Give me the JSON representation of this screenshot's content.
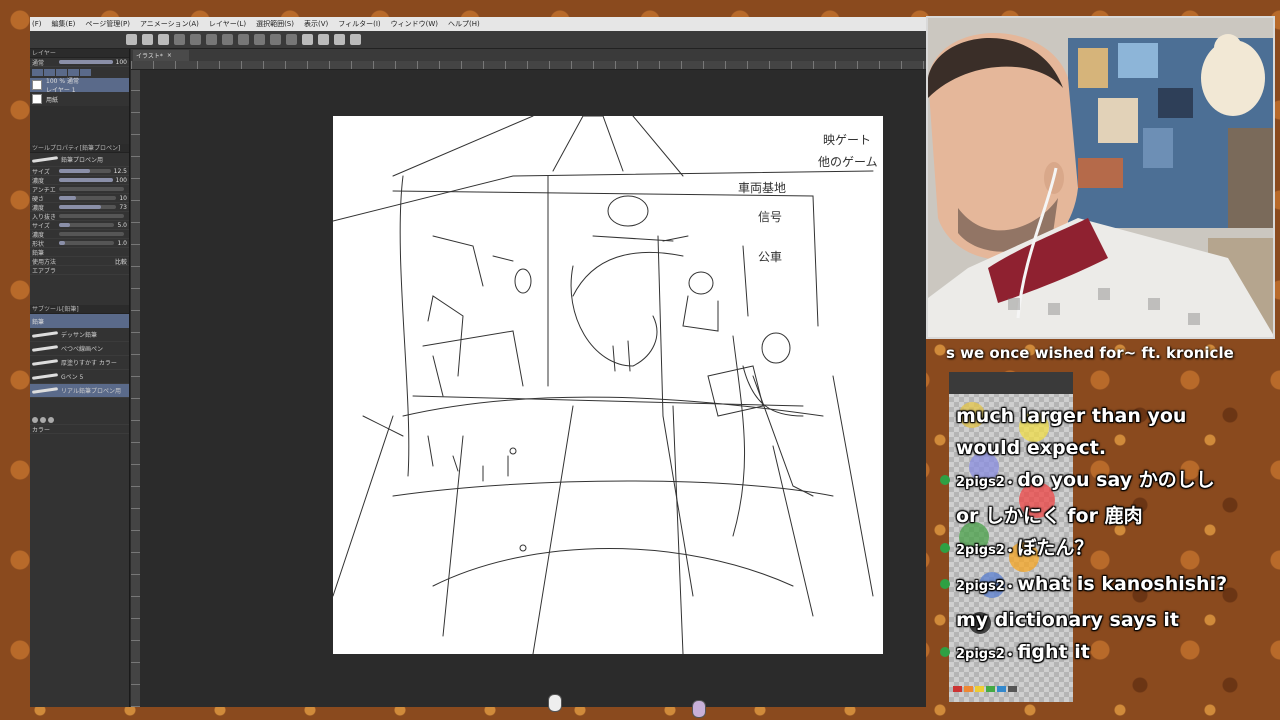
{
  "menu": [
    "(F)",
    "編集(E)",
    "ページ管理(P)",
    "アニメーション(A)",
    "レイヤー(L)",
    "選択範囲(S)",
    "表示(V)",
    "フィルター(I)",
    "ウィンドウ(W)",
    "ヘルプ(H)"
  ],
  "document_tab": "イラスト*",
  "left_panel": {
    "layer_header": "レイヤー",
    "blend_mode": "通常",
    "opacity": "100",
    "layers": [
      {
        "name": "100 % 通常",
        "sub": "レイヤー 1"
      },
      {
        "name": "用紙"
      }
    ],
    "tool_property_title": "ツールプロパティ[鉛筆プロペン]",
    "tool_name": "鉛筆プロペン用",
    "props": [
      {
        "label": "サイズ",
        "value": "12.5",
        "level": 0.6
      },
      {
        "label": "濃度",
        "value": "100",
        "level": 1.0
      },
      {
        "label": "アンチエイリアス",
        "value": "",
        "level": 0
      },
      {
        "label": "硬さ",
        "value": "10",
        "level": 0.3
      },
      {
        "label": "濃度",
        "value": "73",
        "level": 0.73
      },
      {
        "label": "入り抜き",
        "value": "",
        "level": 0
      },
      {
        "label": "サイズ",
        "value": "5.0",
        "level": 0.2
      },
      {
        "label": "濃度",
        "value": "",
        "level": 0
      },
      {
        "label": "形状",
        "value": "1.0",
        "level": 0.1
      }
    ],
    "stroke_label": "鉛筆",
    "ink_label": "比較",
    "ink_label_prefix": "使用方法",
    "brush_label": "エアブラシ",
    "subtool_title": "サブツール[鉛筆]",
    "subtool_active": "鉛筆",
    "brushes": [
      "デッサン鉛筆",
      "べつべ線画ペン",
      "厚塗りすかす カラー",
      "Gペン 5",
      "リアル鉛筆プロペン用"
    ],
    "color_title": "カラー"
  },
  "paper_notes": {
    "note1": "映ゲート",
    "note2": "他のゲーム",
    "note3": "車両基地",
    "note4": "信号",
    "note5": "公車"
  },
  "stream_title": "s we once wished for~ ft. kronicle",
  "chat": [
    {
      "user": "",
      "text": "much larger than you would expect."
    },
    {
      "user": "2pigs2",
      "text": "do you say かのしし or しかにく for 鹿肉"
    },
    {
      "user": "2pigs2",
      "text": "ぼたん？"
    },
    {
      "user": "2pigs2",
      "text": "what is kanoshishi? my dictionary says it"
    },
    {
      "user": "2pigs2",
      "text": "fight it"
    }
  ],
  "colors": {
    "chat_badge": "#2ea043",
    "selection": "#5a6a8a"
  }
}
